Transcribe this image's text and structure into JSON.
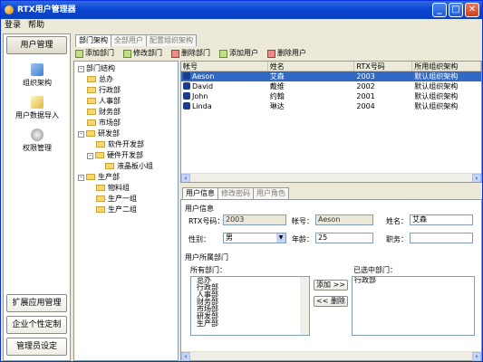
{
  "window": {
    "title": "RTX用户管理器",
    "min_label": "_",
    "max_label": "□",
    "close_label": "✕"
  },
  "menu": [
    "登录",
    "帮助"
  ],
  "sidebar": {
    "top_button": "用户管理",
    "nav": [
      {
        "label": "组织架构",
        "icon": "org-chart-icon"
      },
      {
        "label": "用户数据导入",
        "icon": "import-data-icon"
      },
      {
        "label": "权限管理",
        "icon": "permission-icon"
      }
    ],
    "bottom_buttons": [
      "扩展应用管理",
      "企业个性定制",
      "管理员设定"
    ]
  },
  "top_tabs": [
    "部门架构",
    "全部用户",
    "配置组织架构"
  ],
  "toolbar": {
    "add_dept": "添加部门",
    "edit_dept": "修改部门",
    "delete_dept": "删除部门",
    "add_user": "添加用户",
    "delete_user": "删除用户"
  },
  "tree": {
    "root": "部门结构",
    "expand": "+",
    "collapse": "-",
    "nodes": [
      "总办",
      "行政部",
      "人事部",
      "财务部",
      "市场部",
      "研发部",
      "软件开发部",
      "硬件开发部",
      "液晶板小组",
      "生产部",
      "物料组",
      "生产一组",
      "生产二组"
    ]
  },
  "grid": {
    "columns": [
      "帐号",
      "姓名",
      "RTX号码",
      "所用组织架构"
    ],
    "rows": [
      {
        "account": "Aeson",
        "name": "艾森",
        "rtx": "2003",
        "org": "默认组织架构"
      },
      {
        "account": "David",
        "name": "戴维",
        "rtx": "2002",
        "org": "默认组织架构"
      },
      {
        "account": "John",
        "name": "约翰",
        "rtx": "2001",
        "org": "默认组织架构"
      },
      {
        "account": "Linda",
        "name": "琳达",
        "rtx": "2004",
        "org": "默认组织架构"
      }
    ]
  },
  "detail_tabs": [
    "用户信息",
    "修改密码",
    "用户角色"
  ],
  "user_info": {
    "section_label": "用户信息",
    "rtx_label": "RTX号码：",
    "rtx_value": "2003",
    "account_label": "帐号：",
    "account_value": "Aeson",
    "name_label": "姓名：",
    "name_value": "艾森",
    "gender_label": "性别：",
    "gender_value": "男",
    "age_label": "年龄：",
    "age_value": "25",
    "title_label": "职务：",
    "title_value": ""
  },
  "depts": {
    "section_label": "用户所属部门",
    "all_label": "所有部门：",
    "all_items": [
      "总办",
      "行政部",
      "人事部",
      "财务部",
      "市场部",
      "研发部",
      "生产部"
    ],
    "selected_label": "已选中部门：",
    "selected_items": [
      "行政部"
    ],
    "add_btn": "添加 >>",
    "remove_btn": "<< 删除"
  },
  "colors": {
    "selection": "#316AC5",
    "title": "#0A46D2"
  }
}
